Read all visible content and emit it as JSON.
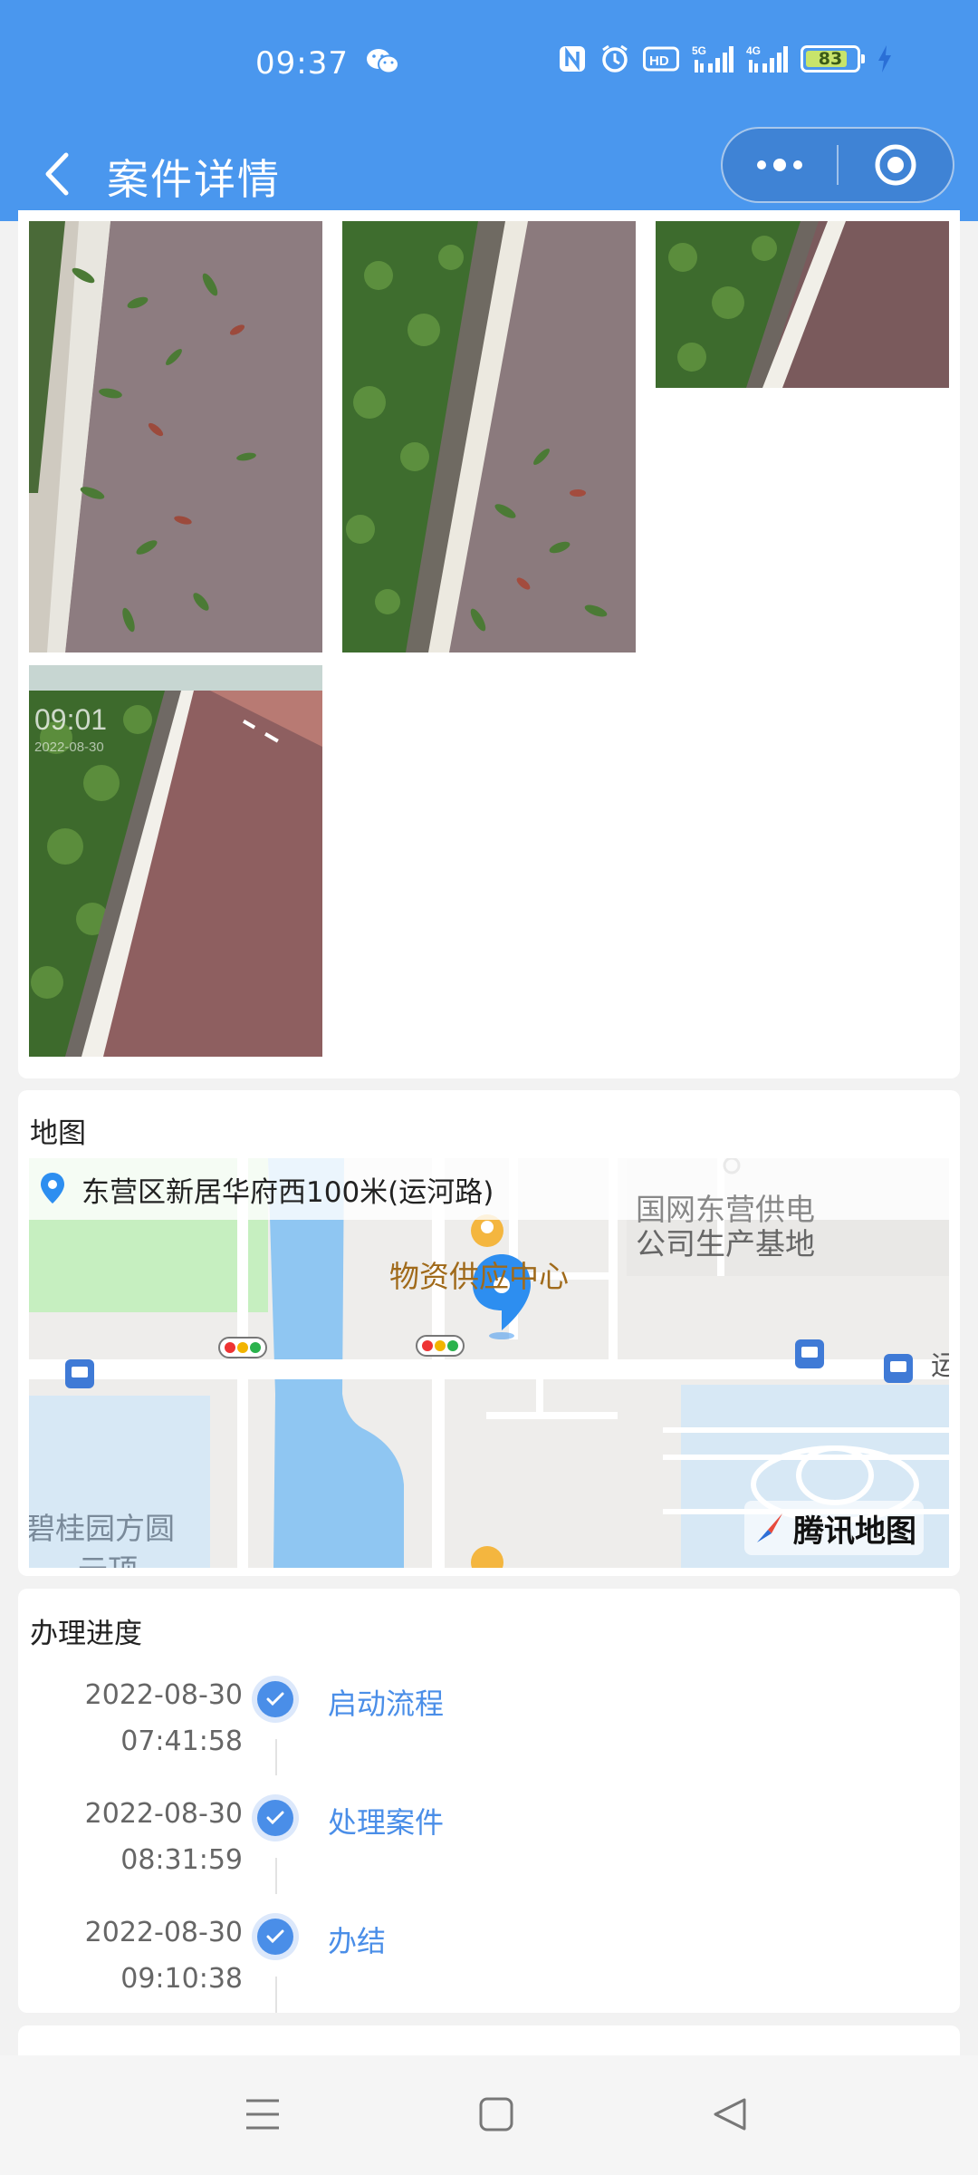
{
  "status_bar": {
    "time": "09:37",
    "icons": [
      "wechat-icon",
      "nfc-icon",
      "alarm-icon",
      "hd-icon",
      "signal-5g-icon",
      "signal-4g-icon"
    ],
    "network_1": "5G",
    "network_2": "4G",
    "battery_level": "83",
    "battery_fraction": 0.83,
    "charging": true
  },
  "nav": {
    "title": "案件详情",
    "back_icon": "chevron-left-icon",
    "more_icon": "more-dots-icon",
    "close_icon": "target-close-icon"
  },
  "photos": {
    "items": [
      {
        "name": "photo-1",
        "desc_icon": "leaves-on-path"
      },
      {
        "name": "photo-2",
        "desc_icon": "leaves-by-hedge"
      },
      {
        "name": "photo-3",
        "desc_icon": "hedge-path"
      },
      {
        "name": "photo-4",
        "stamp_time": "09:01",
        "stamp_date": "2022-08-30"
      }
    ]
  },
  "map": {
    "title": "地图",
    "address": "东营区新居华府西100米(运河路)",
    "labels": {
      "supply_center": "物资供应中心",
      "grid_company_1": "国网东营供电",
      "grid_company_2": "公司生产基地",
      "garden_1": "碧桂园方圆",
      "garden_2": "云顶",
      "edge_road": "运"
    },
    "provider": "腾讯地图",
    "colors": {
      "water": "#8fc6f2",
      "park": "#c6efc0",
      "road": "#ffffff",
      "block": "#eeedeb",
      "pin": "#2d8ef0",
      "poi_label": "#a06a1a"
    }
  },
  "progress": {
    "title": "办理进度",
    "steps": [
      {
        "date": "2022-08-30",
        "time": "07:41:58",
        "label": "启动流程"
      },
      {
        "date": "2022-08-30",
        "time": "08:31:59",
        "label": "处理案件"
      },
      {
        "date": "2022-08-30",
        "time": "09:10:38",
        "label": "办结"
      }
    ],
    "accent": "#4a8ee8"
  },
  "system_nav": {
    "icons": [
      "menu-icon",
      "home-square-icon",
      "back-triangle-icon"
    ]
  },
  "theme": {
    "header_blue": "#4a97ee",
    "page_bg": "#f2f2f2"
  }
}
